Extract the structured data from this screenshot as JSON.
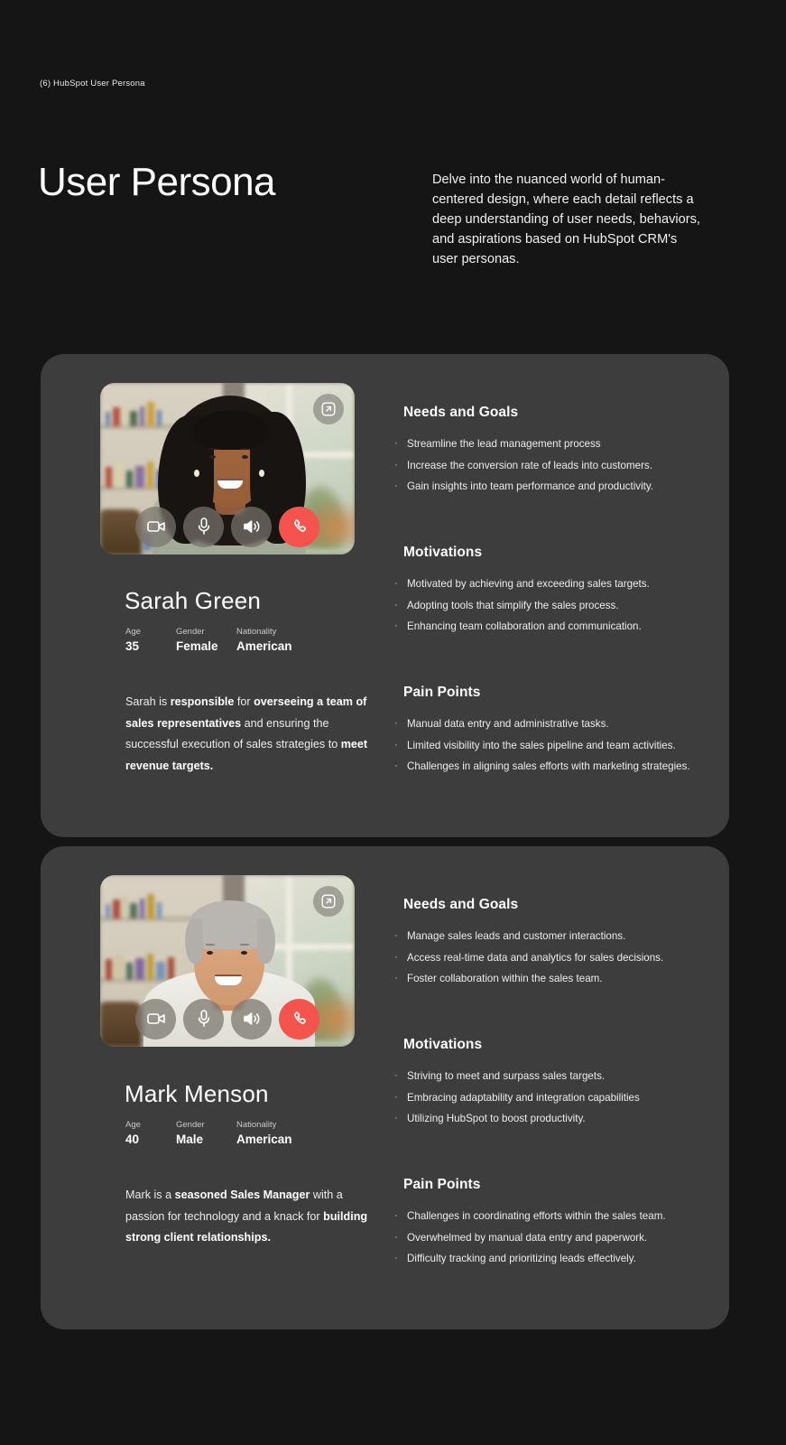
{
  "header": {
    "slide_tag": "(6) HubSpot User Persona",
    "title": "User Persona",
    "intro": "Delve into the nuanced world of human-centered design, where each detail reflects a deep understanding of user needs, behaviors, and aspirations based on HubSpot CRM's user personas."
  },
  "labels": {
    "age": "Age",
    "gender": "Gender",
    "nationality": "Nationality",
    "needs": "Needs and Goals",
    "motivations": "Motivations",
    "pain_points": "Pain Points"
  },
  "colors": {
    "background": "#151515",
    "card": "#3d3d3d",
    "end_call": "#f4544c",
    "control": "#78746c",
    "text": "#ffffff"
  },
  "video_controls": {
    "camera": "camera-icon",
    "microphone": "microphone-icon",
    "speaker": "speaker-icon",
    "end_call": "phone-hangup-icon",
    "expand": "expand-icon"
  },
  "personas": [
    {
      "name": "Sarah Green",
      "age": "35",
      "gender": "Female",
      "nationality": "American",
      "bio": [
        {
          "text": "Sarah is ",
          "bold": false
        },
        {
          "text": "responsible",
          "bold": true
        },
        {
          "text": " for ",
          "bold": false
        },
        {
          "text": "overseeing a team of sales representatives",
          "bold": true
        },
        {
          "text": " and ensuring the successful execution of sales strategies to ",
          "bold": false
        },
        {
          "text": "meet revenue targets.",
          "bold": true
        }
      ],
      "needs_and_goals": [
        "Streamline the lead management process",
        "Increase the conversion rate of leads into customers.",
        "Gain insights into team performance and productivity."
      ],
      "motivations": [
        "Motivated by achieving and exceeding sales targets.",
        "Adopting tools that simplify the sales process.",
        "Enhancing team collaboration and communication."
      ],
      "pain_points": [
        "Manual data entry and administrative tasks.",
        "Limited visibility into the sales pipeline and team activities.",
        "Challenges in aligning sales efforts with marketing strategies."
      ]
    },
    {
      "name": "Mark Menson",
      "age": "40",
      "gender": "Male",
      "nationality": "American",
      "bio": [
        {
          "text": "Mark is a ",
          "bold": false
        },
        {
          "text": "seasoned Sales Manager",
          "bold": true
        },
        {
          "text": " with a passion for technology and a knack for ",
          "bold": false
        },
        {
          "text": "building strong client relationships.",
          "bold": true
        }
      ],
      "needs_and_goals": [
        "Manage sales leads and customer interactions.",
        "Access real-time data and analytics for sales decisions.",
        "Foster collaboration within the sales team."
      ],
      "motivations": [
        "Striving to meet and surpass sales targets.",
        "Embracing adaptability and integration capabilities",
        "Utilizing HubSpot to boost productivity."
      ],
      "pain_points": [
        "Challenges in coordinating efforts within the sales team.",
        "Overwhelmed by manual data entry and paperwork.",
        "Difficulty tracking and prioritizing leads effectively."
      ]
    }
  ]
}
